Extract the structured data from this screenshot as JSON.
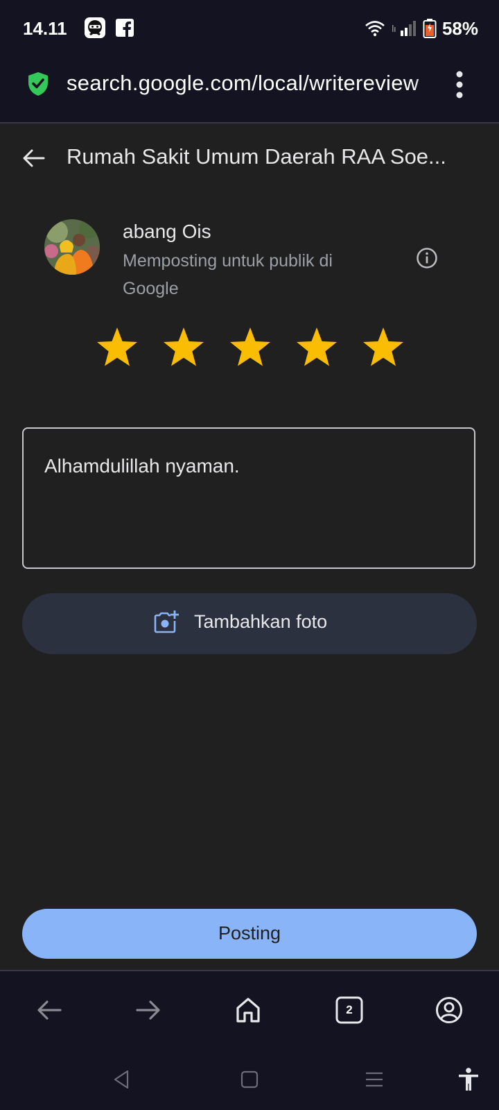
{
  "status_bar": {
    "time": "14.11",
    "battery": "58%",
    "icons": [
      "ninja-app-icon",
      "facebook-icon",
      "wifi-icon",
      "signal-icon",
      "battery-icon"
    ]
  },
  "browser": {
    "url": "search.google.com/local/writereview",
    "secure_icon": "shield-check-icon",
    "menu_icon": "more-vert-icon"
  },
  "header": {
    "title": "Rumah Sakit Umum Daerah RAA Soe...",
    "back_icon": "arrow-back-icon"
  },
  "user": {
    "name": "abang Ois",
    "posting_note": "Memposting untuk publik di Google",
    "info_icon": "info-icon"
  },
  "rating": {
    "stars": 5,
    "max": 5,
    "color": "#fbbc04"
  },
  "review": {
    "text": "Alhamdulillah nyaman."
  },
  "add_photo": {
    "label": "Tambahkan foto",
    "icon": "add-photo-icon"
  },
  "post_button": {
    "label": "Posting",
    "color": "#8ab4f8"
  },
  "browser_nav": {
    "tabs_count": "2",
    "icons": [
      "back-icon",
      "forward-icon",
      "home-icon",
      "tabs-icon",
      "account-icon"
    ]
  },
  "system_nav": {
    "icons": [
      "sys-back-icon",
      "sys-home-icon",
      "sys-recents-icon",
      "accessibility-icon"
    ]
  }
}
